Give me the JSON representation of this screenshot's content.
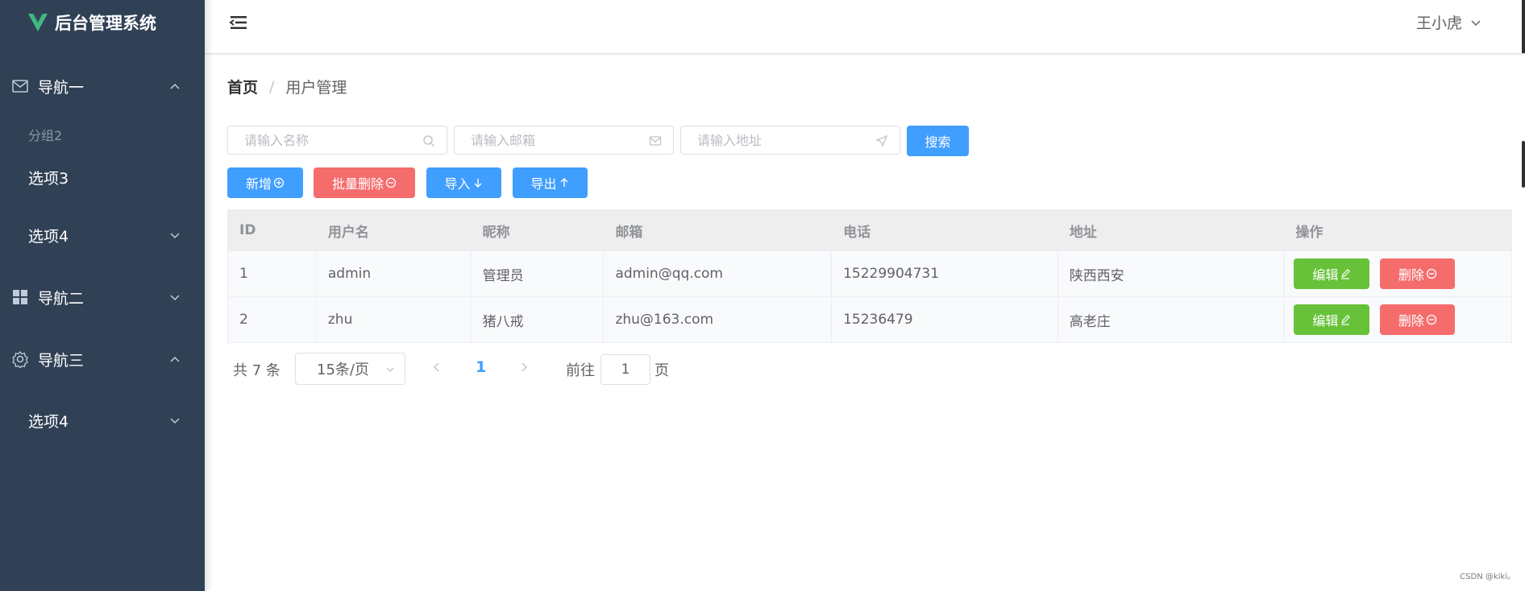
{
  "app": {
    "title": "后台管理系统",
    "brand_color": "#41b883"
  },
  "sidebar": {
    "nav1": {
      "label": "导航一",
      "icon": "mail-icon"
    },
    "group": {
      "label": "分组2"
    },
    "opt3": {
      "label": "选项3"
    },
    "opt4a": {
      "label": "选项4"
    },
    "nav2": {
      "label": "导航二",
      "icon": "grid-icon"
    },
    "nav3": {
      "label": "导航三",
      "icon": "gear-icon"
    },
    "opt4b": {
      "label": "选项4"
    }
  },
  "header": {
    "user": "王小虎"
  },
  "breadcrumb": {
    "home": "首页",
    "separator": "/",
    "current": "用户管理"
  },
  "search": {
    "name_placeholder": "请输入名称",
    "email_placeholder": "请输入邮箱",
    "address_placeholder": "请输入地址",
    "button": "搜索"
  },
  "toolbar": {
    "add": "新增",
    "batch_delete": "批量删除",
    "import": "导入",
    "export": "导出"
  },
  "table": {
    "columns": [
      "ID",
      "用户名",
      "昵称",
      "邮箱",
      "电话",
      "地址",
      "操作"
    ],
    "rows": [
      {
        "id": "1",
        "username": "admin",
        "nickname": "管理员",
        "email": "admin@qq.com",
        "phone": "15229904731",
        "address": "陕西西安"
      },
      {
        "id": "2",
        "username": "zhu",
        "nickname": "猪八戒",
        "email": "zhu@163.com",
        "phone": "15236479",
        "address": "高老庄"
      }
    ],
    "edit_label": "编辑",
    "delete_label": "删除"
  },
  "pagination": {
    "total_text": "共 7 条",
    "page_size": "15条/页",
    "current_page": "1",
    "goto_label": "前往",
    "goto_value": "1",
    "page_suffix": "页"
  },
  "watermark": "CSDN @kiki。",
  "colors": {
    "sidebar": "#304156",
    "primary": "#409eff",
    "danger": "#f56c6c",
    "success": "#67c23a"
  }
}
